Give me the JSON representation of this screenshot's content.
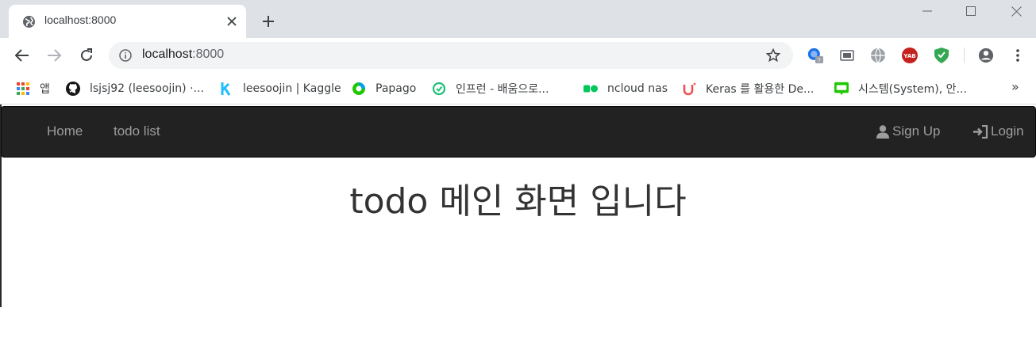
{
  "browser": {
    "tab": {
      "title": "localhost:8000"
    },
    "address": {
      "host": "localhost",
      "port": ":8000"
    }
  },
  "bookmarks": [
    {
      "label": "앱",
      "icon": "apps-grid-icon"
    },
    {
      "label": "lsjsj92 (leesoojin) ·...",
      "icon": "github-icon"
    },
    {
      "label": "leesoojin | Kaggle",
      "icon": "kaggle-icon"
    },
    {
      "label": "Papago",
      "icon": "papago-icon"
    },
    {
      "label": "인프런 - 배움으로...",
      "icon": "inflearn-icon"
    },
    {
      "label": "ncloud nas",
      "icon": "ncloud-icon"
    },
    {
      "label": "Keras 를 활용한 De...",
      "icon": "udemy-icon"
    },
    {
      "label": "시스템(System), 안...",
      "icon": "blog-icon"
    }
  ],
  "overflow": "»",
  "extensions": {
    "yab_label": "YAB"
  },
  "navbar": {
    "home": "Home",
    "todo_list": "todo list",
    "sign_up": "Sign Up",
    "login": "Login"
  },
  "main": {
    "heading": "todo 메인 화면 입니다"
  },
  "colors": {
    "navbar_bg": "#222222",
    "navbar_text": "#9d9d9d",
    "heading_text": "#333333",
    "tabstrip_bg": "#dee1e6"
  }
}
